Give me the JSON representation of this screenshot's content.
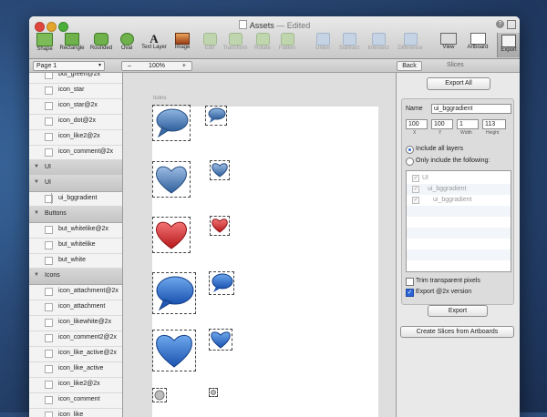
{
  "window": {
    "title": "Assets",
    "status": "— Edited"
  },
  "toolbar": {
    "tools": [
      {
        "label": "Shape",
        "icon": "shape-icon"
      },
      {
        "label": "Rectangle",
        "icon": "rectangle-icon"
      },
      {
        "label": "Rounded",
        "icon": "rounded-rectangle-icon"
      },
      {
        "label": "Oval",
        "icon": "oval-icon"
      },
      {
        "label": "Text Layer",
        "icon": "text-icon",
        "glyph": "A"
      },
      {
        "label": "Image",
        "icon": "image-icon"
      },
      {
        "label": "Edit",
        "icon": "edit-icon"
      },
      {
        "label": "Transform",
        "icon": "transform-icon"
      },
      {
        "label": "Rotate",
        "icon": "rotate-icon"
      },
      {
        "label": "Flatten",
        "icon": "flatten-icon"
      },
      {
        "label": "Union",
        "icon": "union-icon"
      },
      {
        "label": "Subtract",
        "icon": "subtract-icon"
      },
      {
        "label": "Intersect",
        "icon": "intersect-icon"
      },
      {
        "label": "Difference",
        "icon": "difference-icon"
      },
      {
        "label": "View",
        "icon": "view-icon"
      },
      {
        "label": "Artboard",
        "icon": "artboard-icon"
      },
      {
        "label": "Export",
        "icon": "export-icon"
      }
    ]
  },
  "secondbar": {
    "page": "Page 1",
    "zoom": "100%",
    "zoom_minus": "–",
    "zoom_plus": "+",
    "back": "Back",
    "slices_title": "Slices"
  },
  "sidebar": {
    "rows": [
      {
        "type": "item",
        "label": "but_green@2x"
      },
      {
        "type": "item",
        "label": "icon_star"
      },
      {
        "type": "item",
        "label": "icon_star@2x"
      },
      {
        "type": "item",
        "label": "icon_dot@2x"
      },
      {
        "type": "item",
        "label": "icon_like2@2x"
      },
      {
        "type": "item",
        "label": "icon_comment@2x"
      },
      {
        "type": "section",
        "label": "UI"
      },
      {
        "type": "section",
        "label": "UI"
      },
      {
        "type": "sub",
        "label": "ui_bggradient"
      },
      {
        "type": "section",
        "label": "Buttons"
      },
      {
        "type": "item",
        "label": "but_whitelike@2x"
      },
      {
        "type": "item",
        "label": "but_whitelike"
      },
      {
        "type": "item",
        "label": "but_white"
      },
      {
        "type": "section",
        "label": "Icons"
      },
      {
        "type": "item",
        "label": "icon_attachment@2x"
      },
      {
        "type": "item",
        "label": "icon_attachment"
      },
      {
        "type": "item",
        "label": "icon_likewhite@2x"
      },
      {
        "type": "item",
        "label": "icon_comment2@2x"
      },
      {
        "type": "item",
        "label": "icon_like_active@2x"
      },
      {
        "type": "item",
        "label": "icon_like_active"
      },
      {
        "type": "item",
        "label": "icon_like2@2x"
      },
      {
        "type": "item",
        "label": "icon_comment"
      },
      {
        "type": "item",
        "label": "icon_like"
      }
    ]
  },
  "canvas": {
    "artboard_title": "Icons"
  },
  "export_panel": {
    "export_all": "Export All",
    "name_label": "Name",
    "name_value": "ui_bggradient",
    "x": "100",
    "y": "100",
    "width": "1",
    "height": "113",
    "x_caption": "X",
    "y_caption": "Y",
    "width_caption": "Width",
    "height_caption": "Height",
    "include_all": "Include all layers",
    "only_include": "Only include the following:",
    "layers": [
      {
        "label": "UI",
        "indent": 0
      },
      {
        "label": "ui_bggradient",
        "indent": 1
      },
      {
        "label": "ui_bggradient",
        "indent": 2
      }
    ],
    "trim_label": "Trim transparent pixels",
    "export2x_label": "Export @2x version",
    "checkmark": "✓",
    "export_button": "Export",
    "create_slices": "Create Slices from Artboards"
  },
  "colors": {
    "accent": "#2a64d6",
    "bubble_blue": "#2f6fb7",
    "heart_red": "#d8262a",
    "shape_green": "#6fb24b"
  }
}
